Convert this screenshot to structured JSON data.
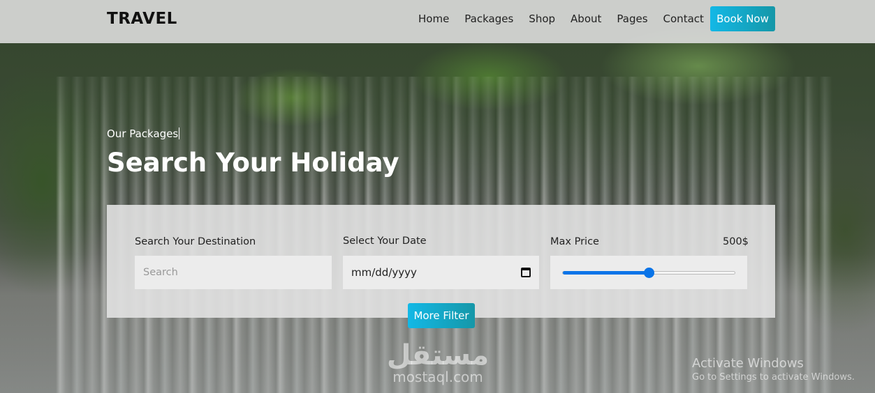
{
  "navbar": {
    "brand": "TRAVEL",
    "links": [
      "Home",
      "Packages",
      "Shop",
      "About",
      "Pages",
      "Contact"
    ],
    "cta_label": "Book Now"
  },
  "hero": {
    "subtitle": "Our Packages",
    "title": "Search Your Holiday"
  },
  "search_form": {
    "destination": {
      "label": "Search Your Destination",
      "placeholder": "Search",
      "value": ""
    },
    "date": {
      "label": "Select Your Date",
      "placeholder": "mm/dd/yyyy"
    },
    "price": {
      "label": "Max Price",
      "value_text": "500$",
      "slider_fraction": 0.5
    },
    "more_filter_label": "More Filter"
  },
  "overlays": {
    "watermark_logo": "مستقل",
    "watermark_site": "mostaql.com",
    "activate_title": "Activate Windows",
    "activate_subtitle": "Go to Settings to activate Windows."
  },
  "colors": {
    "accent_gradient_start": "#13b8e6",
    "accent_gradient_end": "#1597a8",
    "slider_accent": "#0a74e8"
  }
}
